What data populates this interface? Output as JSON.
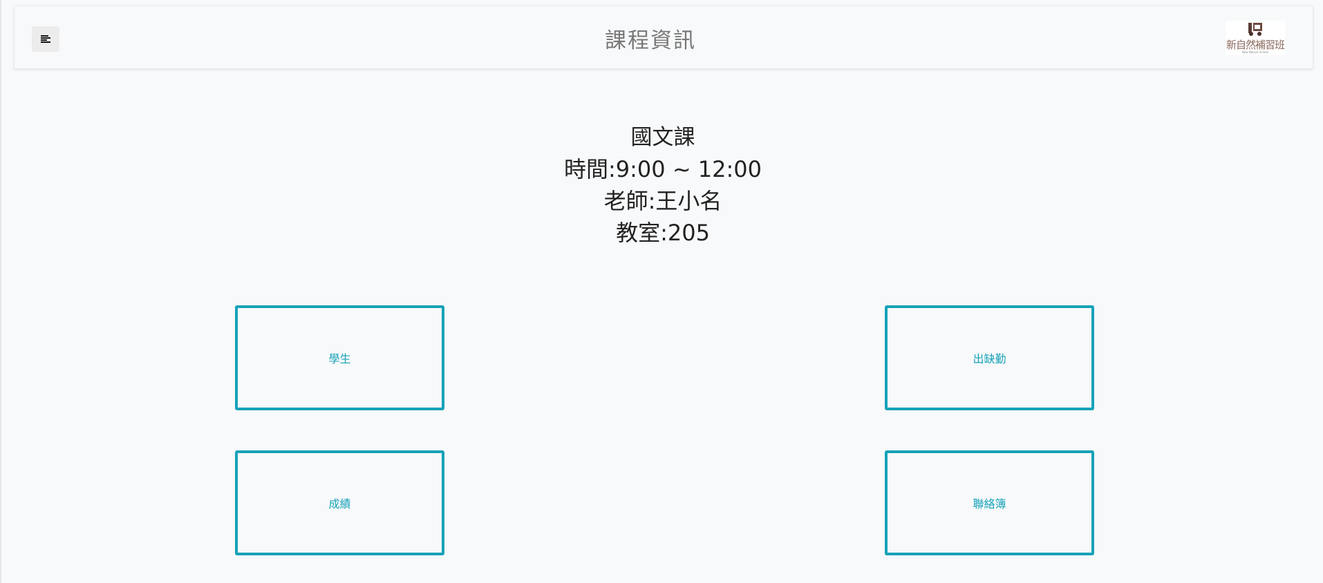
{
  "header": {
    "title": "課程資訊",
    "logo_text": "新自然補習班",
    "logo_subtext": "New Nature School"
  },
  "course": {
    "subject": "國文課",
    "time_label": "時間:",
    "time_value": "9:00 ~ 12:00",
    "teacher_label": "老師:",
    "teacher_value": "王小名",
    "classroom_label": "教室:",
    "classroom_value": "205"
  },
  "tiles": {
    "students": "學生",
    "attendance": "出缺勤",
    "grades": "成績",
    "contact_book": "聯絡簿"
  },
  "colors": {
    "accent": "#17a2b8",
    "background": "#f8f9fa"
  },
  "icons": {
    "menu": "menu-icon",
    "logo": "logo-mark"
  }
}
